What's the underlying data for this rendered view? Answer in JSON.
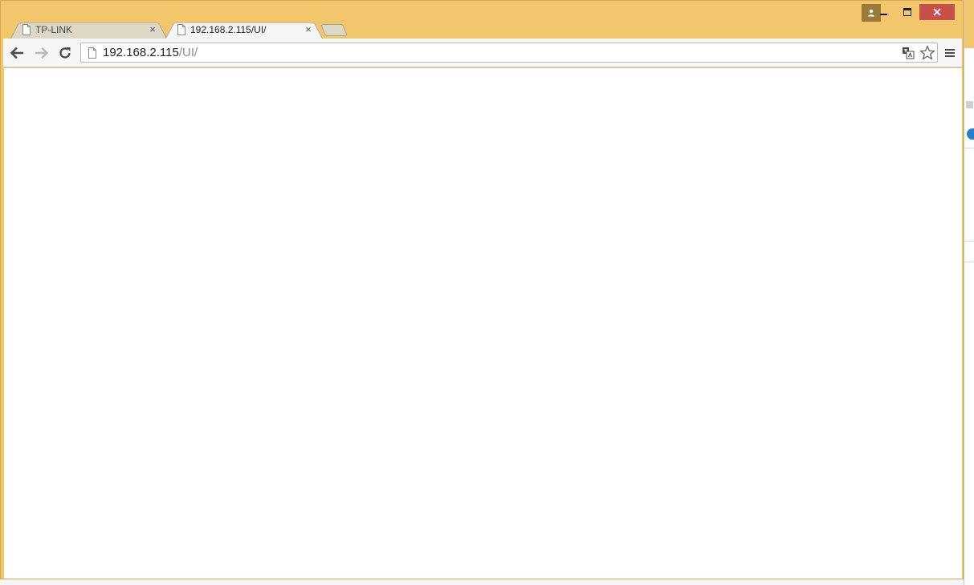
{
  "browser": {
    "tabs": [
      {
        "title": "TP-LINK",
        "close_icon": "close-icon",
        "active": false
      },
      {
        "title": "192.168.2.115/UI/",
        "close_icon": "close-icon",
        "active": true
      }
    ],
    "tab_close_glyph": "×",
    "address": {
      "host": "192.168.2.115",
      "path": "/UI/"
    },
    "icons": [
      "back-arrow-icon",
      "forward-arrow-icon",
      "reload-icon",
      "page-icon",
      "translate-icon",
      "star-icon",
      "menu-icon",
      "profile-icon",
      "minimize-icon",
      "maximize-icon",
      "close-icon"
    ]
  },
  "colors": {
    "frame": "#f2c66b",
    "close_button": "#c7504b",
    "profile_button": "#9b7b3c"
  }
}
